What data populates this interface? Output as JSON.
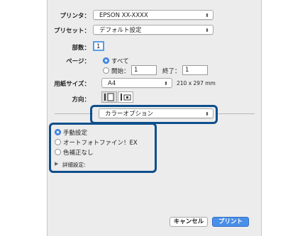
{
  "printer": {
    "label": "プリンタ：",
    "value": "EPSON XX-XXXX"
  },
  "preset": {
    "label": "プリセット：",
    "value": "デフォルト設定"
  },
  "copies": {
    "label": "部数：",
    "value": "1"
  },
  "pages": {
    "label": "ページ：",
    "all_label": "すべて",
    "from_label": "開始：",
    "from_value": "1",
    "to_label": "終了：",
    "to_value": "1"
  },
  "paper": {
    "label": "用紙サイズ：",
    "value": "A4",
    "size_text": "210 x 297 mm"
  },
  "orientation": {
    "label": "方向："
  },
  "section": {
    "value": "カラーオプション"
  },
  "color_options": [
    {
      "label": "手動設定",
      "selected": true
    },
    {
      "label": "オートフォトファイン！EX",
      "selected": false
    },
    {
      "label": "色補正なし",
      "selected": false
    }
  ],
  "advanced": {
    "label": "詳細設定:"
  },
  "buttons": {
    "cancel": "キャンセル",
    "print": "プリント"
  },
  "colors": {
    "highlight": "#0d4f8b",
    "accent": "#4a90e8"
  }
}
